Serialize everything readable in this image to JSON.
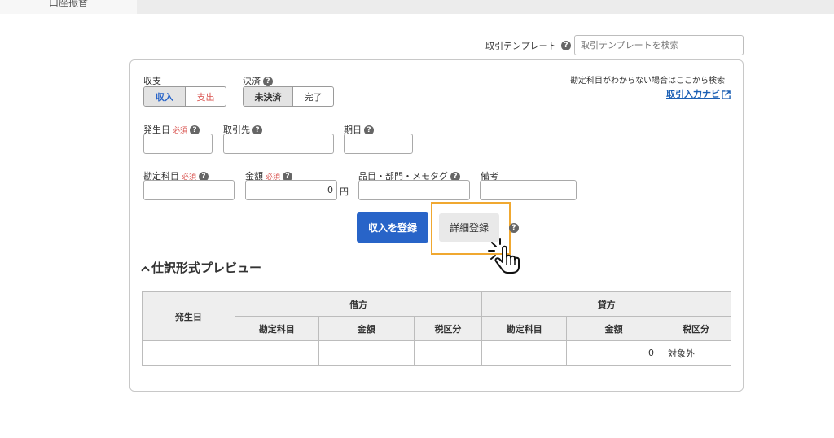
{
  "top_tab": {
    "label": "口座振替"
  },
  "template": {
    "label": "取引テンプレート",
    "placeholder": "取引テンプレートを検索"
  },
  "form": {
    "income_expense": {
      "label": "収支",
      "options": [
        "収入",
        "支出"
      ],
      "selected": "収入"
    },
    "settlement": {
      "label": "決済",
      "options": [
        "未決済",
        "完了"
      ],
      "selected": "未決済"
    },
    "hint_text": "勘定科目がわからない場合はここから検索",
    "navi_link": "取引入力ナビ",
    "date": {
      "label": "発生日",
      "required": "必須",
      "value": ""
    },
    "partner": {
      "label": "取引先",
      "value": ""
    },
    "due_date": {
      "label": "期日",
      "value": ""
    },
    "account": {
      "label": "勘定科目",
      "required": "必須",
      "value": ""
    },
    "amount": {
      "label": "金額",
      "required": "必須",
      "value": "0",
      "unit": "円"
    },
    "tags": {
      "label": "品目・部門・メモタグ",
      "value": ""
    },
    "notes": {
      "label": "備考",
      "value": ""
    },
    "register_button": "収入を登録",
    "detail_button": "詳細登録"
  },
  "preview": {
    "title": "仕訳形式プレビュー",
    "headers": {
      "date": "発生日",
      "debit": "借方",
      "credit": "貸方",
      "account": "勘定科目",
      "amount": "金額",
      "tax": "税区分"
    },
    "row": {
      "date": "",
      "debit_account": "",
      "debit_amount": "",
      "debit_tax": "",
      "credit_account": "",
      "credit_amount": "0",
      "credit_tax": "対象外"
    }
  },
  "colors": {
    "primary": "#2864c8",
    "highlight": "#f0a830",
    "required": "#d9534f",
    "link": "#1a5fb4"
  }
}
